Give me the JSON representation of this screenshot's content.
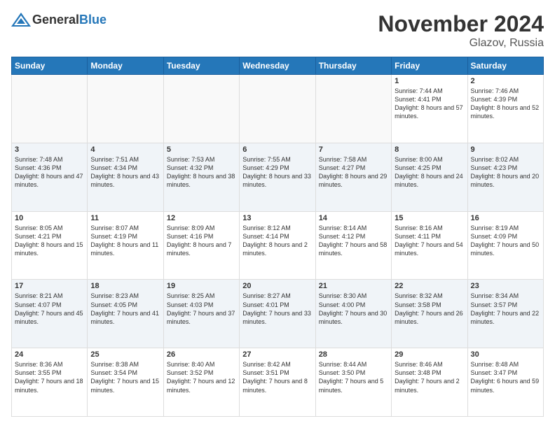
{
  "logo": {
    "general": "General",
    "blue": "Blue"
  },
  "header": {
    "month": "November 2024",
    "location": "Glazov, Russia"
  },
  "weekdays": [
    "Sunday",
    "Monday",
    "Tuesday",
    "Wednesday",
    "Thursday",
    "Friday",
    "Saturday"
  ],
  "weeks": [
    [
      {
        "day": "",
        "info": ""
      },
      {
        "day": "",
        "info": ""
      },
      {
        "day": "",
        "info": ""
      },
      {
        "day": "",
        "info": ""
      },
      {
        "day": "",
        "info": ""
      },
      {
        "day": "1",
        "info": "Sunrise: 7:44 AM\nSunset: 4:41 PM\nDaylight: 8 hours and 57 minutes."
      },
      {
        "day": "2",
        "info": "Sunrise: 7:46 AM\nSunset: 4:39 PM\nDaylight: 8 hours and 52 minutes."
      }
    ],
    [
      {
        "day": "3",
        "info": "Sunrise: 7:48 AM\nSunset: 4:36 PM\nDaylight: 8 hours and 47 minutes."
      },
      {
        "day": "4",
        "info": "Sunrise: 7:51 AM\nSunset: 4:34 PM\nDaylight: 8 hours and 43 minutes."
      },
      {
        "day": "5",
        "info": "Sunrise: 7:53 AM\nSunset: 4:32 PM\nDaylight: 8 hours and 38 minutes."
      },
      {
        "day": "6",
        "info": "Sunrise: 7:55 AM\nSunset: 4:29 PM\nDaylight: 8 hours and 33 minutes."
      },
      {
        "day": "7",
        "info": "Sunrise: 7:58 AM\nSunset: 4:27 PM\nDaylight: 8 hours and 29 minutes."
      },
      {
        "day": "8",
        "info": "Sunrise: 8:00 AM\nSunset: 4:25 PM\nDaylight: 8 hours and 24 minutes."
      },
      {
        "day": "9",
        "info": "Sunrise: 8:02 AM\nSunset: 4:23 PM\nDaylight: 8 hours and 20 minutes."
      }
    ],
    [
      {
        "day": "10",
        "info": "Sunrise: 8:05 AM\nSunset: 4:21 PM\nDaylight: 8 hours and 15 minutes."
      },
      {
        "day": "11",
        "info": "Sunrise: 8:07 AM\nSunset: 4:19 PM\nDaylight: 8 hours and 11 minutes."
      },
      {
        "day": "12",
        "info": "Sunrise: 8:09 AM\nSunset: 4:16 PM\nDaylight: 8 hours and 7 minutes."
      },
      {
        "day": "13",
        "info": "Sunrise: 8:12 AM\nSunset: 4:14 PM\nDaylight: 8 hours and 2 minutes."
      },
      {
        "day": "14",
        "info": "Sunrise: 8:14 AM\nSunset: 4:12 PM\nDaylight: 7 hours and 58 minutes."
      },
      {
        "day": "15",
        "info": "Sunrise: 8:16 AM\nSunset: 4:11 PM\nDaylight: 7 hours and 54 minutes."
      },
      {
        "day": "16",
        "info": "Sunrise: 8:19 AM\nSunset: 4:09 PM\nDaylight: 7 hours and 50 minutes."
      }
    ],
    [
      {
        "day": "17",
        "info": "Sunrise: 8:21 AM\nSunset: 4:07 PM\nDaylight: 7 hours and 45 minutes."
      },
      {
        "day": "18",
        "info": "Sunrise: 8:23 AM\nSunset: 4:05 PM\nDaylight: 7 hours and 41 minutes."
      },
      {
        "day": "19",
        "info": "Sunrise: 8:25 AM\nSunset: 4:03 PM\nDaylight: 7 hours and 37 minutes."
      },
      {
        "day": "20",
        "info": "Sunrise: 8:27 AM\nSunset: 4:01 PM\nDaylight: 7 hours and 33 minutes."
      },
      {
        "day": "21",
        "info": "Sunrise: 8:30 AM\nSunset: 4:00 PM\nDaylight: 7 hours and 30 minutes."
      },
      {
        "day": "22",
        "info": "Sunrise: 8:32 AM\nSunset: 3:58 PM\nDaylight: 7 hours and 26 minutes."
      },
      {
        "day": "23",
        "info": "Sunrise: 8:34 AM\nSunset: 3:57 PM\nDaylight: 7 hours and 22 minutes."
      }
    ],
    [
      {
        "day": "24",
        "info": "Sunrise: 8:36 AM\nSunset: 3:55 PM\nDaylight: 7 hours and 18 minutes."
      },
      {
        "day": "25",
        "info": "Sunrise: 8:38 AM\nSunset: 3:54 PM\nDaylight: 7 hours and 15 minutes."
      },
      {
        "day": "26",
        "info": "Sunrise: 8:40 AM\nSunset: 3:52 PM\nDaylight: 7 hours and 12 minutes."
      },
      {
        "day": "27",
        "info": "Sunrise: 8:42 AM\nSunset: 3:51 PM\nDaylight: 7 hours and 8 minutes."
      },
      {
        "day": "28",
        "info": "Sunrise: 8:44 AM\nSunset: 3:50 PM\nDaylight: 7 hours and 5 minutes."
      },
      {
        "day": "29",
        "info": "Sunrise: 8:46 AM\nSunset: 3:48 PM\nDaylight: 7 hours and 2 minutes."
      },
      {
        "day": "30",
        "info": "Sunrise: 8:48 AM\nSunset: 3:47 PM\nDaylight: 6 hours and 59 minutes."
      }
    ]
  ]
}
